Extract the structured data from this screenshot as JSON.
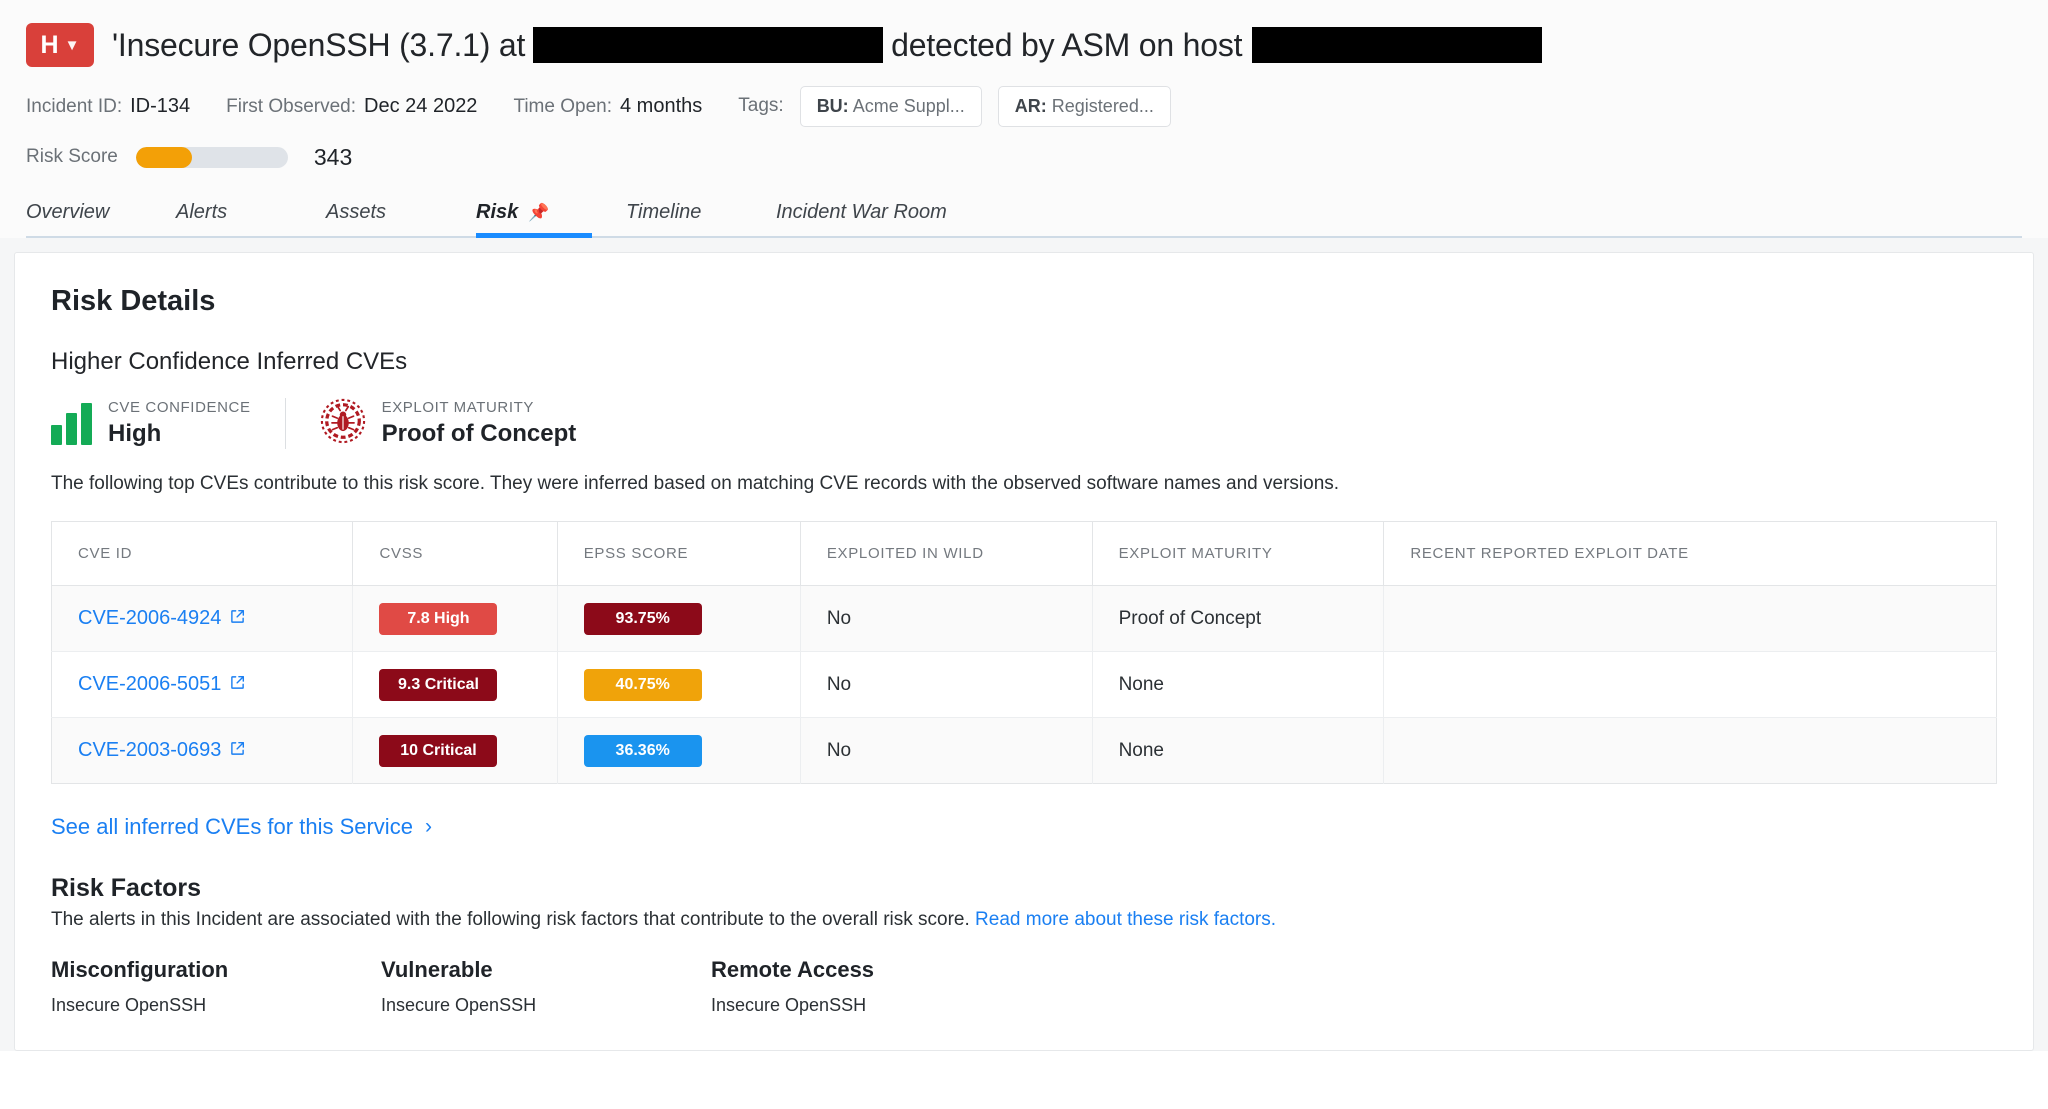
{
  "header": {
    "severity_badge": "H",
    "severity_chevron": "chevron-down-icon",
    "title_part1": "'Insecure OpenSSH (3.7.1) at",
    "title_part2": "detected by ASM on host",
    "redaction_1": "redacted",
    "redaction_2": "redacted",
    "meta": {
      "incident_id_label": "Incident ID:",
      "incident_id_value": "ID-134",
      "first_observed_label": "First Observed:",
      "first_observed_value": "Dec 24 2022",
      "time_open_label": "Time Open:",
      "time_open_value": "4 months",
      "tags_label": "Tags:",
      "tags": [
        {
          "key": "BU:",
          "value": "Acme Suppl..."
        },
        {
          "key": "AR:",
          "value": "Registered..."
        }
      ]
    },
    "risk": {
      "label": "Risk Score",
      "value": "343",
      "fill_percent": 37,
      "fill_color": "#f3a007",
      "track_color": "#dfe3e8"
    }
  },
  "tabs": [
    {
      "label": "Overview",
      "active": false,
      "pinned": false
    },
    {
      "label": "Alerts",
      "active": false,
      "pinned": false
    },
    {
      "label": "Assets",
      "active": false,
      "pinned": false
    },
    {
      "label": "Risk",
      "active": true,
      "pinned": true,
      "pin_glyph": "📌"
    },
    {
      "label": "Timeline",
      "active": false,
      "pinned": false
    },
    {
      "label": "Incident War Room",
      "active": false,
      "pinned": false
    }
  ],
  "main": {
    "section_title": "Risk Details",
    "sub_title": "Higher Confidence Inferred CVEs",
    "confidence": {
      "cve_confidence_caption": "CVE CONFIDENCE",
      "cve_confidence_value": "High",
      "cve_confidence_color": "#14ab56",
      "exploit_maturity_caption": "EXPLOIT MATURITY",
      "exploit_maturity_value": "Proof of Concept",
      "exploit_maturity_color": "#b01a22"
    },
    "description": "The following top CVEs contribute to this risk score. They were inferred based on matching CVE records with the observed software names and versions.",
    "table": {
      "columns": [
        "CVE ID",
        "CVSS",
        "EPSS SCORE",
        "EXPLOITED IN WILD",
        "EXPLOIT MATURITY",
        "RECENT REPORTED EXPLOIT DATE"
      ],
      "rows": [
        {
          "cve_id": "CVE-2006-4924",
          "cvss_label": "7.8 High",
          "cvss_color": "#e04a45",
          "epss_label": "93.75%",
          "epss_color": "#8c0a19",
          "exploited_in_wild": "No",
          "exploit_maturity": "Proof of Concept",
          "recent_reported_exploit_date": ""
        },
        {
          "cve_id": "CVE-2006-5051",
          "cvss_label": "9.3 Critical",
          "cvss_color": "#8c0a19",
          "epss_label": "40.75%",
          "epss_color": "#f0a30a",
          "exploited_in_wild": "No",
          "exploit_maturity": "None",
          "recent_reported_exploit_date": ""
        },
        {
          "cve_id": "CVE-2003-0693",
          "cvss_label": "10 Critical",
          "cvss_color": "#8c0a19",
          "epss_label": "36.36%",
          "epss_color": "#1a94ef",
          "exploited_in_wild": "No",
          "exploit_maturity": "None",
          "recent_reported_exploit_date": ""
        }
      ]
    },
    "see_all_link": "See all inferred CVEs for this Service",
    "risk_factors": {
      "title": "Risk Factors",
      "description_text": "The alerts in this Incident are associated with the following risk factors that contribute to the overall risk score.",
      "description_link": "Read more about these risk factors.",
      "items": [
        {
          "title": "Misconfiguration",
          "value": "Insecure OpenSSH"
        },
        {
          "title": "Vulnerable",
          "value": "Insecure OpenSSH"
        },
        {
          "title": "Remote Access",
          "value": "Insecure OpenSSH"
        }
      ]
    }
  }
}
